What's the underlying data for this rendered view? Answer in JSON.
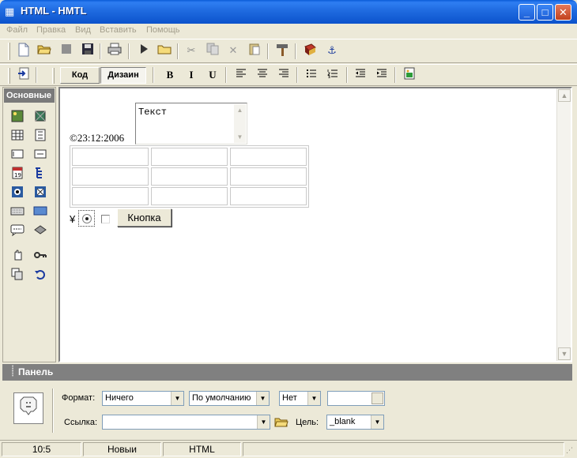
{
  "window": {
    "title": "HTML - HMTL",
    "minimize_glyph": "_",
    "maximize_glyph": "□",
    "close_glyph": "✕"
  },
  "menu": [
    "Файл",
    "Правка",
    "Вид",
    "Вставить",
    "Помощь"
  ],
  "toolbar1": {
    "icons": [
      "new-file-icon",
      "open-folder-icon",
      "stop-icon",
      "save-icon",
      "print-icon",
      "run-icon",
      "folder-icon",
      "cut-icon",
      "copy-icon",
      "delete-icon",
      "paste-icon",
      "hammer-icon",
      "book-icon",
      "anchor-icon"
    ]
  },
  "toolbar2": {
    "mode_code": "Код",
    "mode_design": "Дизаин",
    "bold": "B",
    "italic": "I",
    "underline": "U"
  },
  "palette": {
    "header": "Основные"
  },
  "canvas": {
    "copyright_text": "©23:12:2006",
    "textarea_value": "Текст",
    "yen_symbol": "¥",
    "button_label": "Кнопка",
    "radio_checked": true,
    "checkbox_checked": false
  },
  "panel": {
    "title": "Панель",
    "format_label": "Формат:",
    "format_value": "Ничего",
    "align_value": "По умолчанию",
    "yesno_value": "Нет",
    "link_label": "Ссылка:",
    "link_value": "",
    "target_label": "Цель:",
    "target_value": "_blank"
  },
  "status": {
    "position": "10:5",
    "file": "Новыи",
    "mode": "HTML"
  }
}
